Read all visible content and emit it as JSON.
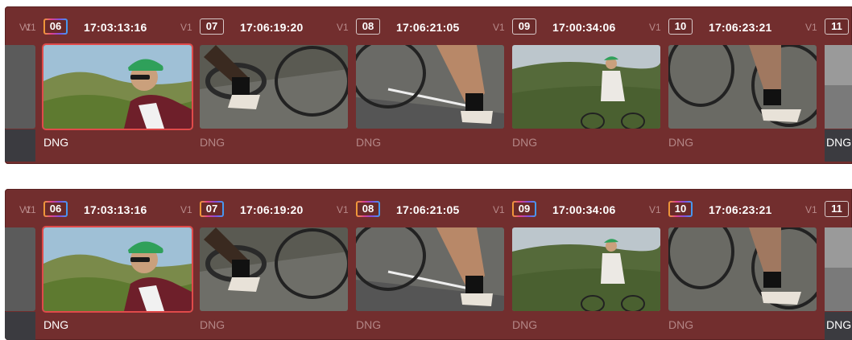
{
  "rows": [
    {
      "id": "top",
      "lead_track": "V1",
      "clips": [
        {
          "track": "V1",
          "number": "06",
          "timecode": "17:03:13:16",
          "format": "DNG",
          "graded": true,
          "selected": true,
          "format_active": true,
          "thumb": "cyclist-portrait"
        },
        {
          "track": "V1",
          "number": "07",
          "timecode": "17:06:19:20",
          "format": "DNG",
          "graded": false,
          "selected": false,
          "format_active": false,
          "thumb": "pedal-closeup"
        },
        {
          "track": "V1",
          "number": "08",
          "timecode": "17:06:21:05",
          "format": "DNG",
          "graded": false,
          "selected": false,
          "format_active": false,
          "thumb": "leg-wheel"
        },
        {
          "track": "V1",
          "number": "09",
          "timecode": "17:00:34:06",
          "format": "DNG",
          "graded": false,
          "selected": false,
          "format_active": false,
          "thumb": "cyclist-hill"
        },
        {
          "track": "V1",
          "number": "10",
          "timecode": "17:06:23:21",
          "format": "DNG",
          "graded": false,
          "selected": false,
          "format_active": false,
          "thumb": "rear-wheel"
        },
        {
          "track": "V1",
          "number": "11",
          "timecode": "",
          "format": "DNG",
          "graded": false,
          "selected": false,
          "format_active": true,
          "thumb": "partial"
        }
      ]
    },
    {
      "id": "bottom",
      "lead_track": "V1",
      "clips": [
        {
          "track": "V1",
          "number": "06",
          "timecode": "17:03:13:16",
          "format": "DNG",
          "graded": true,
          "selected": true,
          "format_active": true,
          "thumb": "cyclist-portrait"
        },
        {
          "track": "V1",
          "number": "07",
          "timecode": "17:06:19:20",
          "format": "DNG",
          "graded": true,
          "selected": false,
          "format_active": false,
          "thumb": "pedal-closeup"
        },
        {
          "track": "V1",
          "number": "08",
          "timecode": "17:06:21:05",
          "format": "DNG",
          "graded": true,
          "selected": false,
          "format_active": false,
          "thumb": "leg-wheel"
        },
        {
          "track": "V1",
          "number": "09",
          "timecode": "17:00:34:06",
          "format": "DNG",
          "graded": true,
          "selected": false,
          "format_active": false,
          "thumb": "cyclist-hill"
        },
        {
          "track": "V1",
          "number": "10",
          "timecode": "17:06:23:21",
          "format": "DNG",
          "graded": true,
          "selected": false,
          "format_active": false,
          "thumb": "rear-wheel"
        },
        {
          "track": "V1",
          "number": "11",
          "timecode": "",
          "format": "DNG",
          "graded": false,
          "selected": false,
          "format_active": true,
          "thumb": "partial"
        }
      ]
    }
  ]
}
